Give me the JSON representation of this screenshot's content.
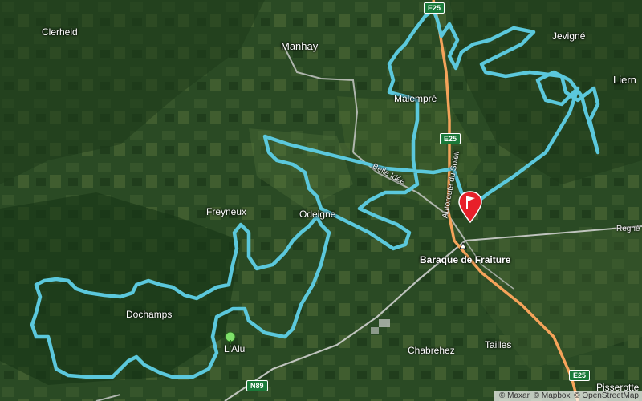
{
  "map": {
    "places": {
      "clerheid": "Clerheid",
      "manhay": "Manhay",
      "jevigne": "Jevigné",
      "lierneux": "Liern",
      "malempre": "Malempré",
      "freyneux": "Freyneux",
      "odeigne": "Odeigne",
      "baraque": "Baraque de Fraiture",
      "dochamps": "Dochamps",
      "lalu": "L'Alu",
      "chabrehez": "Chabrehez",
      "tailles": "Tailles",
      "pisserotte": "Pisserotte",
      "regne": "Regné"
    },
    "roads": {
      "e25_top": "E25",
      "e25_mid": "E25",
      "e25_bottom": "E25",
      "n89": "N89",
      "autoroute": "Autoroute du Soleil",
      "belle_idee": "Belle Idée"
    },
    "colors": {
      "route": "#5bc8dc",
      "marker": "#e8202a",
      "highway": "#f5a35a"
    }
  },
  "attribution": {
    "maxar": "© Maxar",
    "mapbox": "© Mapbox",
    "osm": "© OpenStreetMap"
  }
}
